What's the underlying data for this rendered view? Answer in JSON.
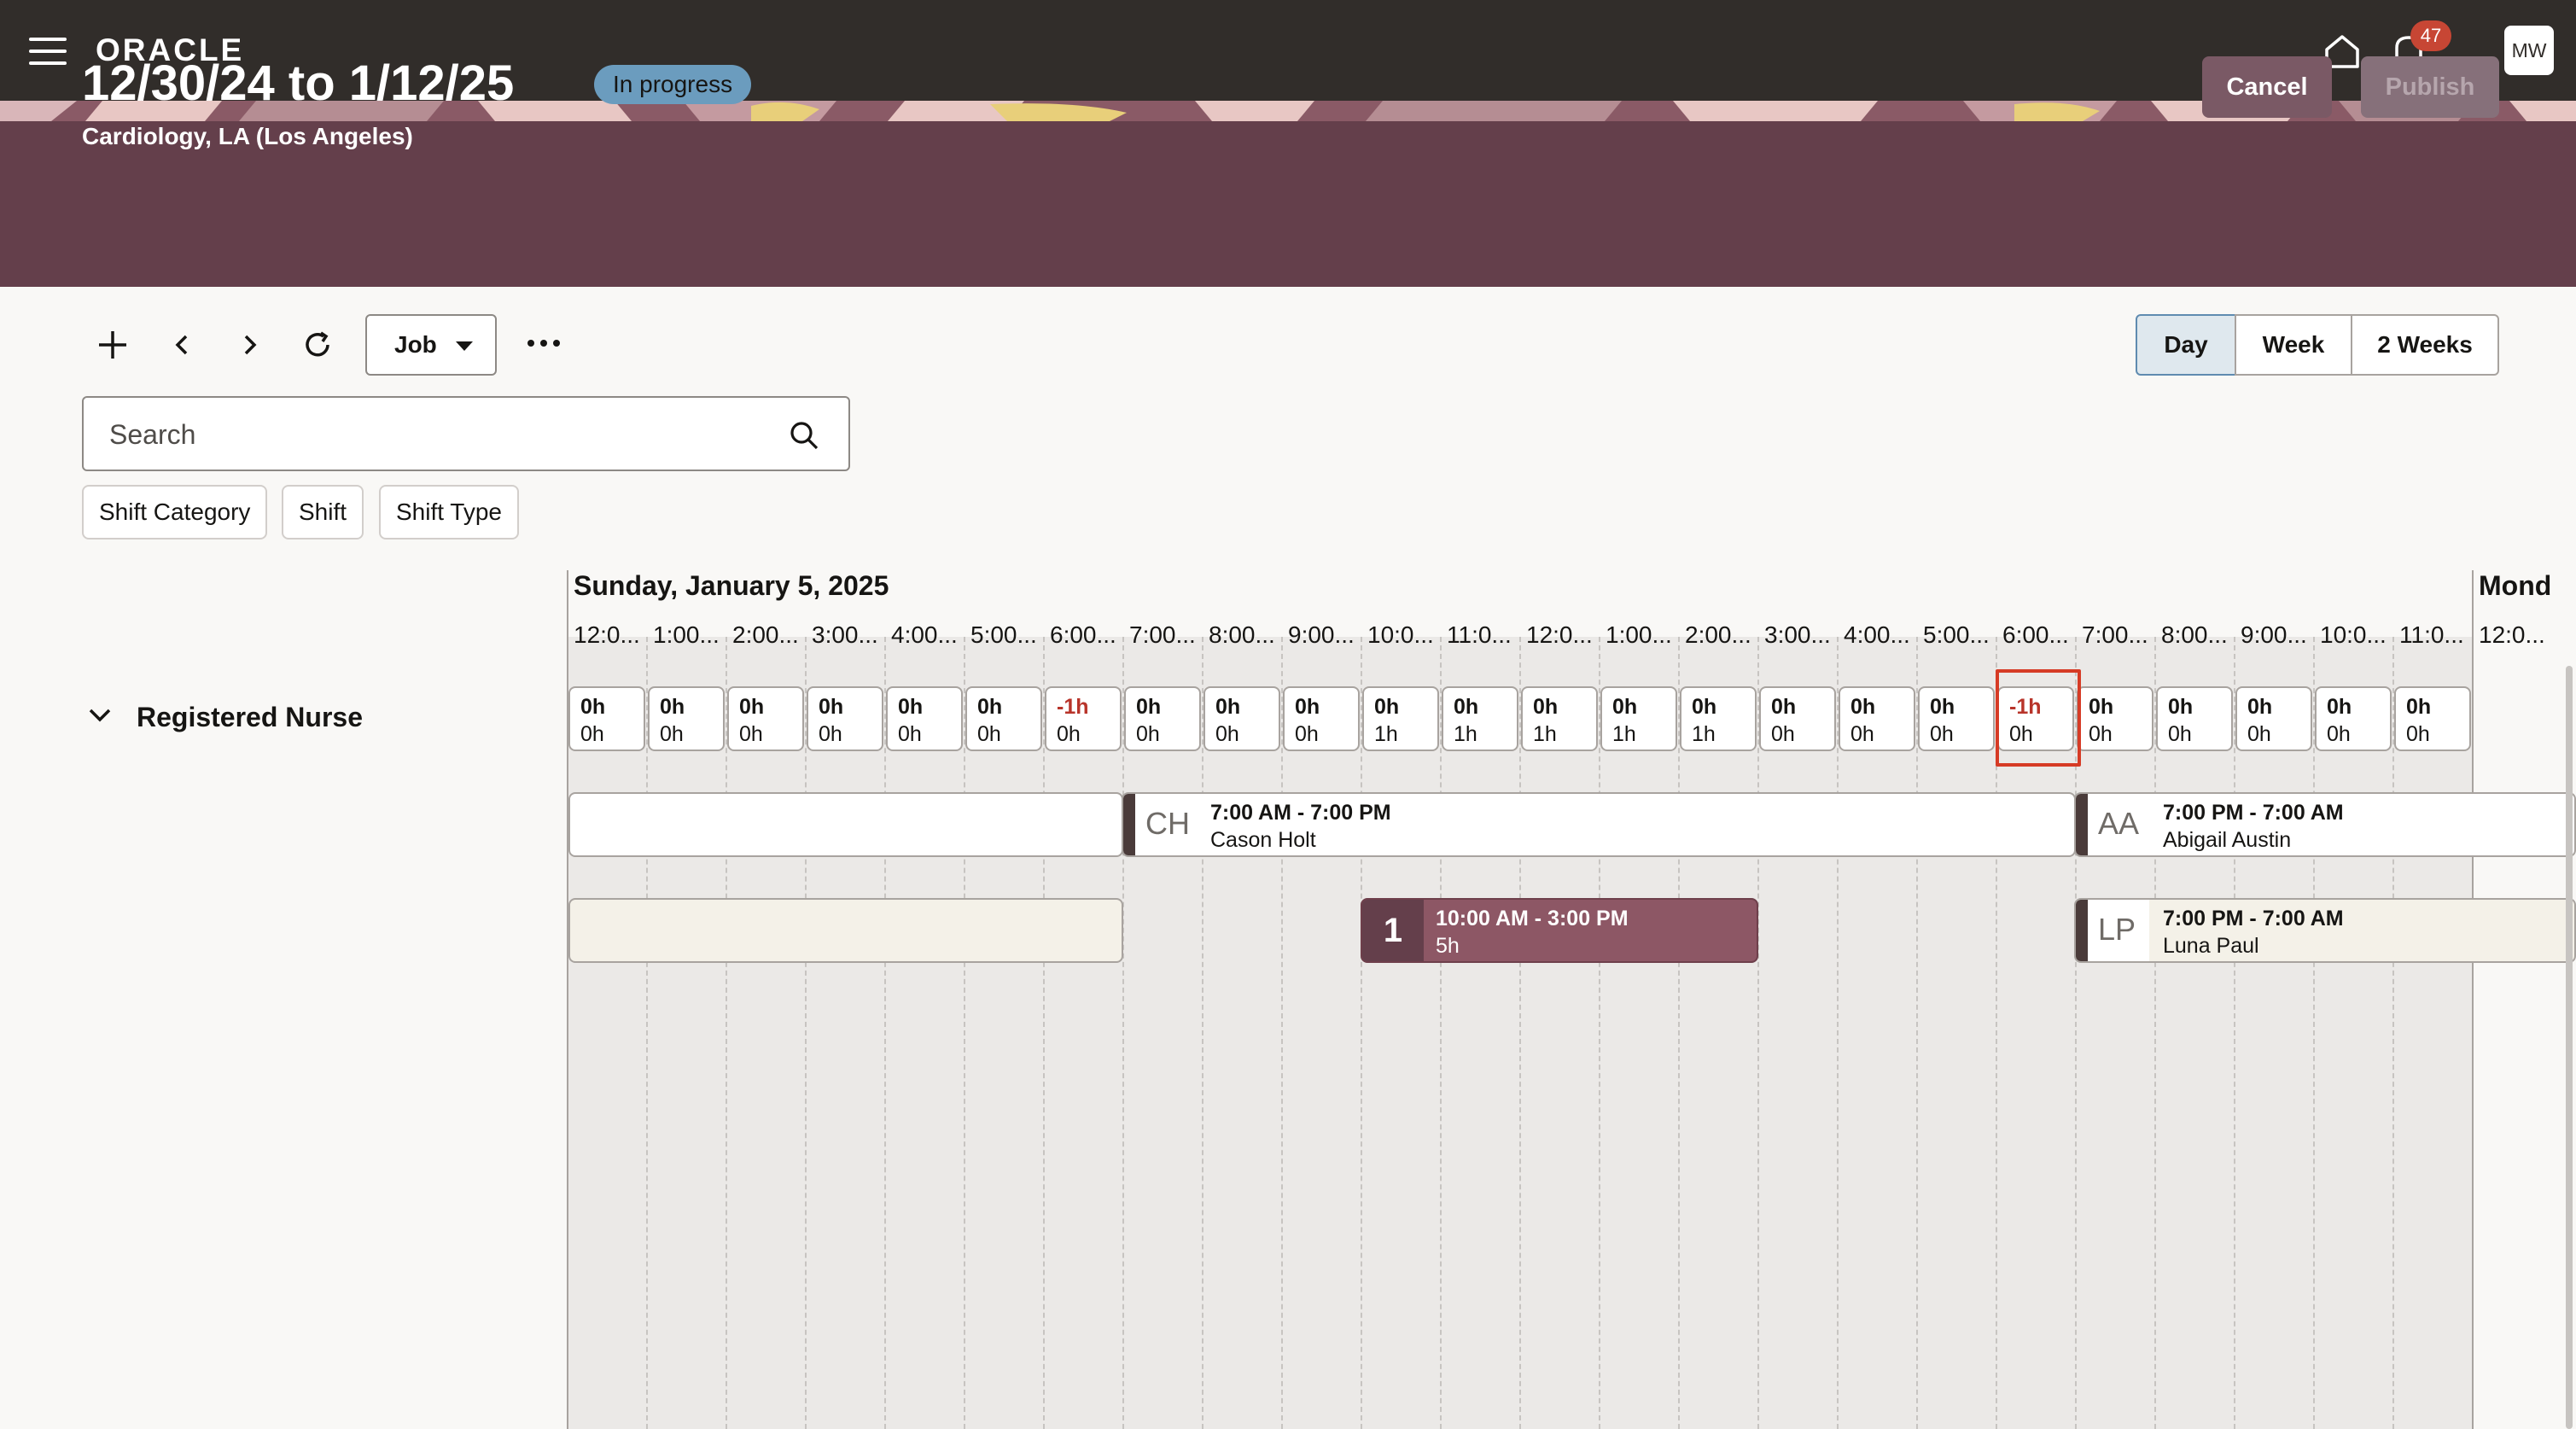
{
  "header": {
    "logo": "ORACLE",
    "notification_count": "47",
    "avatar_initials": "MW"
  },
  "banner": {
    "title": "12/30/24 to 1/12/25",
    "status": "In progress",
    "subtitle": "Cardiology, LA (Los Angeles)",
    "cancel_label": "Cancel",
    "publish_label": "Publish"
  },
  "toolbar": {
    "job_label": "Job",
    "views": [
      "Day",
      "Week",
      "2 Weeks"
    ],
    "selected_view": "Day"
  },
  "search": {
    "placeholder": "Search"
  },
  "filters": [
    "Shift Category",
    "Shift",
    "Shift Type"
  ],
  "schedule": {
    "date": "Sunday, January 5, 2025",
    "next_date": "Mond",
    "hours": [
      "12:0...",
      "1:00...",
      "2:00...",
      "3:00...",
      "4:00...",
      "5:00...",
      "6:00...",
      "7:00...",
      "8:00...",
      "9:00...",
      "10:0...",
      "11:0...",
      "12:0...",
      "1:00...",
      "2:00...",
      "3:00...",
      "4:00...",
      "5:00...",
      "6:00...",
      "7:00...",
      "8:00...",
      "9:00...",
      "10:0...",
      "11:0...",
      "12:0..."
    ],
    "row_label": "Registered Nurse",
    "coverage": [
      {
        "top": "0h",
        "bottom": "0h"
      },
      {
        "top": "0h",
        "bottom": "0h"
      },
      {
        "top": "0h",
        "bottom": "0h"
      },
      {
        "top": "0h",
        "bottom": "0h"
      },
      {
        "top": "0h",
        "bottom": "0h"
      },
      {
        "top": "0h",
        "bottom": "0h"
      },
      {
        "top": "-1h",
        "bottom": "0h"
      },
      {
        "top": "0h",
        "bottom": "0h"
      },
      {
        "top": "0h",
        "bottom": "0h"
      },
      {
        "top": "0h",
        "bottom": "0h"
      },
      {
        "top": "0h",
        "bottom": "1h"
      },
      {
        "top": "0h",
        "bottom": "1h"
      },
      {
        "top": "0h",
        "bottom": "1h"
      },
      {
        "top": "0h",
        "bottom": "1h"
      },
      {
        "top": "0h",
        "bottom": "1h"
      },
      {
        "top": "0h",
        "bottom": "0h"
      },
      {
        "top": "0h",
        "bottom": "0h"
      },
      {
        "top": "0h",
        "bottom": "0h"
      },
      {
        "top": "-1h",
        "bottom": "0h"
      },
      {
        "top": "0h",
        "bottom": "0h"
      },
      {
        "top": "0h",
        "bottom": "0h"
      },
      {
        "top": "0h",
        "bottom": "0h"
      },
      {
        "top": "0h",
        "bottom": "0h"
      },
      {
        "top": "0h",
        "bottom": "0h"
      }
    ],
    "shifts": {
      "ch": {
        "initials": "CH",
        "time": "7:00 AM - 7:00 PM",
        "person": "Cason Holt"
      },
      "aa": {
        "initials": "AA",
        "time": "7:00 PM - 7:00 AM",
        "person": "Abigail Austin"
      },
      "open": {
        "count": "1",
        "time": "10:00 AM - 3:00 PM",
        "duration": "5h"
      },
      "lp": {
        "initials": "LP",
        "time": "7:00 PM - 7:00 AM",
        "person": "Luna Paul"
      }
    }
  },
  "colors": {
    "topbar": "#312d2a",
    "banner": "#643f4b",
    "status_badge": "#6b9cbe",
    "negative": "#b8342a",
    "highlight": "#d63b25"
  }
}
